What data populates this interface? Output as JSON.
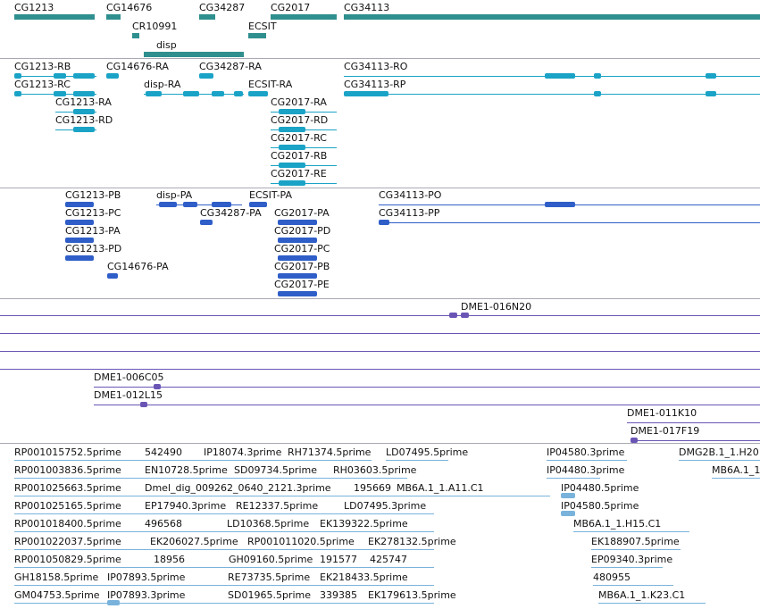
{
  "genes": [
    {
      "name": "CG1213"
    },
    {
      "name": "CG14676"
    },
    {
      "name": "CG34287"
    },
    {
      "name": "CG2017"
    },
    {
      "name": "CG34113"
    },
    {
      "name": "CR10991"
    },
    {
      "name": "ECSIT"
    },
    {
      "name": "disp"
    }
  ],
  "transcripts": [
    {
      "name": "CG1213-RB"
    },
    {
      "name": "CG14676-RA"
    },
    {
      "name": "CG34287-RA"
    },
    {
      "name": "CG34113-RO"
    },
    {
      "name": "CG1213-RC"
    },
    {
      "name": "disp-RA"
    },
    {
      "name": "ECSIT-RA"
    },
    {
      "name": "CG34113-RP"
    },
    {
      "name": "CG1213-RA"
    },
    {
      "name": "CG2017-RA"
    },
    {
      "name": "CG1213-RD"
    },
    {
      "name": "CG2017-RD"
    },
    {
      "name": "CG2017-RC"
    },
    {
      "name": "CG2017-RB"
    },
    {
      "name": "CG2017-RE"
    }
  ],
  "proteins": [
    {
      "name": "CG1213-PB"
    },
    {
      "name": "disp-PA"
    },
    {
      "name": "ECSIT-PA"
    },
    {
      "name": "CG34113-PO"
    },
    {
      "name": "CG1213-PC"
    },
    {
      "name": "CG34287-PA"
    },
    {
      "name": "CG2017-PA"
    },
    {
      "name": "CG34113-PP"
    },
    {
      "name": "CG1213-PA"
    },
    {
      "name": "CG2017-PD"
    },
    {
      "name": "CG1213-PD"
    },
    {
      "name": "CG2017-PC"
    },
    {
      "name": "CG14676-PA"
    },
    {
      "name": "CG2017-PB"
    },
    {
      "name": "CG2017-PE"
    }
  ],
  "clones_top": [
    {
      "name": "DME1-016N20"
    }
  ],
  "clones_bottom": [
    {
      "name": "DME1-006C05"
    },
    {
      "name": "DME1-012L15"
    },
    {
      "name": "DME1-011K10"
    },
    {
      "name": "DME1-017F19"
    }
  ],
  "ests": [
    "RP001015752.5prime",
    "542490",
    "IP18074.3prime",
    "RH71374.5prime",
    "LD07495.5prime",
    "IP04580.3prime",
    "DMG2B.1_1.H20",
    "RP001003836.5prime",
    "EN10728.5prime",
    "SD09734.5prime",
    "RH03603.5prime",
    "IP04480.3prime",
    "MB6A.1_1",
    "RP001025663.5prime",
    "Dmel_dig_009262_0640_2121.3prime",
    "195669",
    "MB6A.1_1.A11.C1",
    "IP04480.5prime",
    "RP001025165.5prime",
    "EP17940.3prime",
    "RE12337.5prime",
    "LD07495.3prime",
    "IP04580.5prime",
    "RP001018400.5prime",
    "496568",
    "LD10368.5prime",
    "EK139322.5prime",
    "MB6A.1_1.H15.C1",
    "RP001022037.5prime",
    "EK206027.5prime",
    "RP001011020.5prime",
    "EK278132.5prime",
    "EK188907.5prime",
    "RP001050829.5prime",
    "18956",
    "GH09160.5prime",
    "191577",
    "425747",
    "EP09340.3prime",
    "GH18158.5prime",
    "IP07893.5prime",
    "RE73735.5prime",
    "EK218433.5prime",
    "480955",
    "GM04753.5prime",
    "IP07893.3prime",
    "SD01965.5prime",
    "339385",
    "EK179613.5prime",
    "MB6A.1_1.K23.C1"
  ],
  "colors": {
    "gene": "#2f8f8f",
    "transcript": "#1aa3c6",
    "protein": "#2f5ec8",
    "clone": "#6a55b5",
    "est": "#79b3dc",
    "separator": "#a9a9b5"
  }
}
